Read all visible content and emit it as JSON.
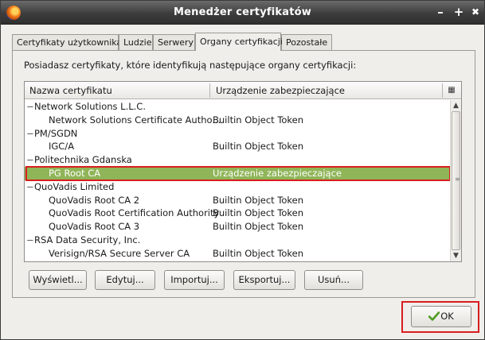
{
  "window": {
    "title": "Menedżer certyfikatów",
    "controls": {
      "minimize": "–",
      "maximize": "+",
      "close": "✖"
    }
  },
  "tabs": [
    {
      "label": "Certyfikaty użytkownika",
      "active": false
    },
    {
      "label": "Ludzie",
      "active": false
    },
    {
      "label": "Serwery",
      "active": false
    },
    {
      "label": "Organy certyfikacji",
      "active": true
    },
    {
      "label": "Pozostałe",
      "active": false
    }
  ],
  "panel": {
    "description": "Posiadasz certyfikaty, które identyfikują następujące organy certyfikacji:"
  },
  "tree": {
    "columns": [
      "Nazwa certyfikatu",
      "Urządzenie zabezpieczające"
    ],
    "rows": [
      {
        "type": "group",
        "name": "Network Solutions L.L.C."
      },
      {
        "type": "item",
        "name": "Network Solutions Certificate Autho...",
        "device": "Builtin Object Token"
      },
      {
        "type": "group",
        "name": "PM/SGDN"
      },
      {
        "type": "item",
        "name": "IGC/A",
        "device": "Builtin Object Token"
      },
      {
        "type": "group",
        "name": "Politechnika Gdanska"
      },
      {
        "type": "item",
        "name": "PG Root CA",
        "device": "Urządzenie zabezpieczające",
        "selected": true
      },
      {
        "type": "group",
        "name": "QuoVadis Limited"
      },
      {
        "type": "item",
        "name": "QuoVadis Root CA 2",
        "device": "Builtin Object Token"
      },
      {
        "type": "item",
        "name": "QuoVadis Root Certification Authority",
        "device": "Builtin Object Token"
      },
      {
        "type": "item",
        "name": "QuoVadis Root CA 3",
        "device": "Builtin Object Token"
      },
      {
        "type": "group",
        "name": "RSA Data Security, Inc."
      },
      {
        "type": "item",
        "name": "Verisign/RSA Secure Server CA",
        "device": "Builtin Object Token"
      }
    ]
  },
  "buttons": {
    "view": "Wyświetl...",
    "edit": "Edytuj...",
    "import": "Importuj...",
    "export": "Eksportuj...",
    "delete": "Usuń...",
    "ok": "OK"
  },
  "colors": {
    "selection": "#8fb558",
    "highlight_outline": "#d81e1e"
  }
}
